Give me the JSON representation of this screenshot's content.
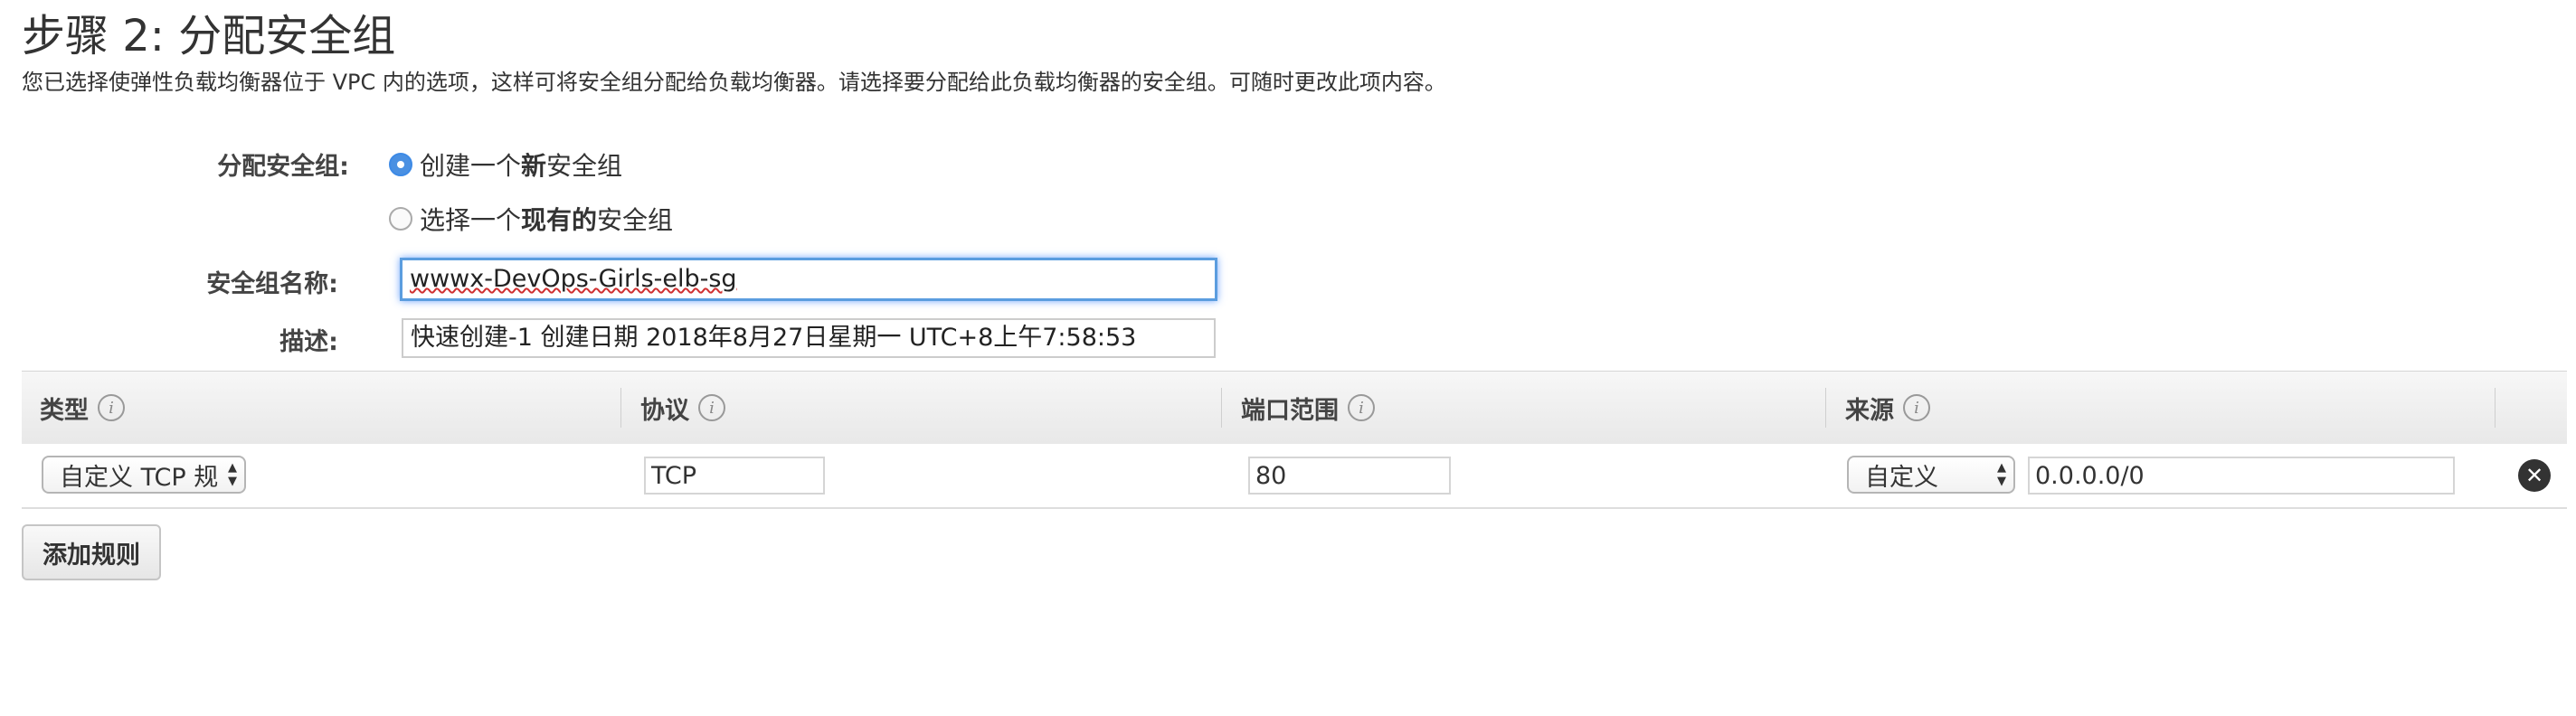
{
  "header": {
    "title": "步骤 2: 分配安全组",
    "description": "您已选择使弹性负载均衡器位于 VPC 内的选项，这样可将安全组分配给负载均衡器。请选择要分配给此负载均衡器的安全组。可随时更改此项内容。"
  },
  "form": {
    "assign_label": "分配安全组:",
    "options": [
      {
        "prefix": "创建一个",
        "bold": "新",
        "suffix": "安全组",
        "checked": true
      },
      {
        "prefix": "选择一个",
        "bold": "现有的",
        "suffix": "安全组",
        "checked": false
      }
    ],
    "name_label": "安全组名称:",
    "name_value": "wwwx-DevOps-Girls-elb-sg",
    "description_label": "描述:",
    "description_value": "快速创建-1 创建日期 2018年8月27日星期一 UTC+8上午7:58:53"
  },
  "table": {
    "headers": [
      "类型",
      "协议",
      "端口范围",
      "来源"
    ],
    "rows": [
      {
        "type": "自定义 TCP 规",
        "protocol": "TCP",
        "port_range": "80",
        "source_type": "自定义",
        "source": "0.0.0.0/0"
      }
    ]
  },
  "actions": {
    "add_rule_label": "添加规则"
  },
  "icons": {
    "info": "info-icon",
    "remove": "remove-circle-icon",
    "select_arrows": "updown-arrows-icon"
  },
  "colors": {
    "radio_checked": "#4a90e2",
    "focus_ring": "#5b9ddf",
    "spellcheck_underline": "#d03030"
  }
}
